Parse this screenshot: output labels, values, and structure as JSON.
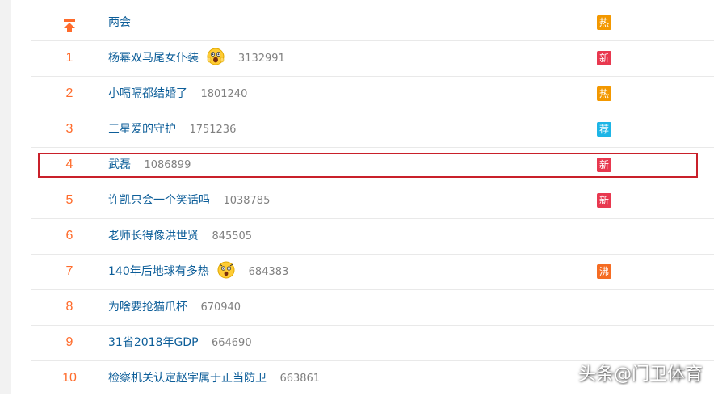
{
  "colors": {
    "rank": "#ff6b2b",
    "link": "#0d5e99",
    "count": "#808080",
    "badge_hot": "#f39800",
    "badge_new": "#e8384f",
    "badge_rec": "#1db5e6",
    "badge_boil": "#f56c23",
    "highlight": "#c9202a"
  },
  "rows": [
    {
      "rank": "",
      "title": "两会",
      "count": "",
      "badge": "热",
      "badge_type": "hot",
      "pinned": true
    },
    {
      "rank": "1",
      "title": "杨幂双马尾女仆装",
      "count": "3132991",
      "badge": "新",
      "badge_type": "new",
      "emoji": "shocked-face-icon"
    },
    {
      "rank": "2",
      "title": "小嗝嗝都结婚了",
      "count": "1801240",
      "badge": "热",
      "badge_type": "hot"
    },
    {
      "rank": "3",
      "title": "三星爱的守护",
      "count": "1751236",
      "badge": "荐",
      "badge_type": "rec"
    },
    {
      "rank": "4",
      "title": "武磊",
      "count": "1086899",
      "badge": "新",
      "badge_type": "new"
    },
    {
      "rank": "5",
      "title": "许凯只会一个笑话吗",
      "count": "1038785",
      "badge": "新",
      "badge_type": "new"
    },
    {
      "rank": "6",
      "title": "老师长得像洪世贤",
      "count": "845505",
      "badge": "",
      "badge_type": ""
    },
    {
      "rank": "7",
      "title": "140年后地球有多热",
      "count": "684383",
      "badge": "沸",
      "badge_type": "boil",
      "emoji": "surprised-face-icon"
    },
    {
      "rank": "8",
      "title": "为啥要抢猫爪杯",
      "count": "670940",
      "badge": "",
      "badge_type": ""
    },
    {
      "rank": "9",
      "title": "31省2018年GDP",
      "count": "664690",
      "badge": "",
      "badge_type": ""
    },
    {
      "rank": "10",
      "title": "检察机关认定赵宇属于正当防卫",
      "count": "663861",
      "badge": "",
      "badge_type": ""
    }
  ],
  "watermark": "头条@门卫体育"
}
